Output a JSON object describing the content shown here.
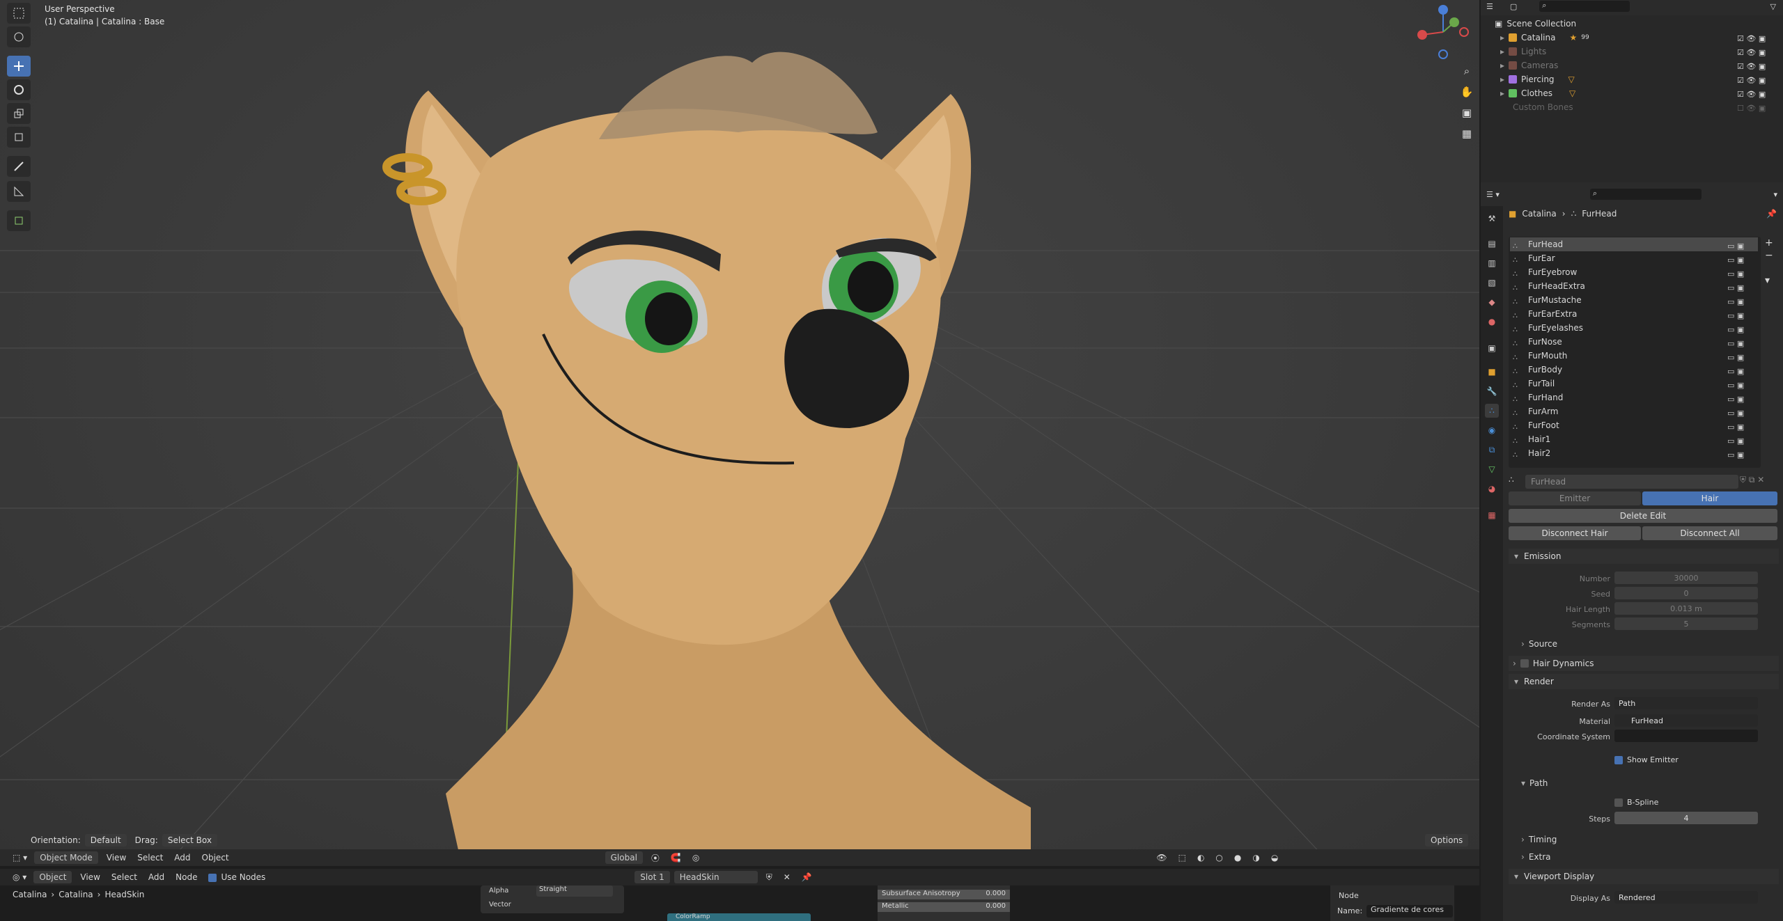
{
  "viewport": {
    "perspective_label": "User Perspective",
    "object_label": "(1) Catalina | Catalina : Base",
    "orientation_label": "Orientation:",
    "orientation_value": "Default",
    "drag_label": "Drag:",
    "drag_value": "Select Box",
    "options_label": "Options"
  },
  "viewport_header": {
    "mode": "Object Mode",
    "menus": [
      "View",
      "Select",
      "Add",
      "Object"
    ],
    "transform_orientation": "Global"
  },
  "node_editor": {
    "editor_type": "Object",
    "menus": [
      "View",
      "Select",
      "Add",
      "Node"
    ],
    "use_nodes_label": "Use Nodes",
    "slot": "Slot 1",
    "material": "HeadSkin",
    "breadcrumb": [
      "Catalina",
      "Catalina",
      "HeadSkin"
    ],
    "alpha_label": "Alpha",
    "alpha_value": "Straight",
    "vector_label": "Vector",
    "colorramp_label": "ColorRamp",
    "subsurface_label": "Subsurface Anisotropy",
    "subsurface_value": "0.000",
    "metallic_label": "Metallic",
    "metallic_value": "0.000",
    "node_panel_label": "Node",
    "name_label": "Name:",
    "name_value": "Gradiente de cores"
  },
  "outliner": {
    "root": "Scene Collection",
    "items": [
      {
        "label": "Catalina",
        "color": "#e0a030",
        "badge": "99"
      },
      {
        "label": "Lights",
        "color": "#c07060",
        "badge": ""
      },
      {
        "label": "Cameras",
        "color": "#c07060",
        "badge": ""
      },
      {
        "label": "Piercing",
        "color": "#a070e0",
        "badge": ""
      },
      {
        "label": "Clothes",
        "color": "#60c060",
        "badge": ""
      },
      {
        "label": "Custom Bones",
        "color": "#666666",
        "badge": ""
      }
    ]
  },
  "properties": {
    "breadcrumb": [
      "Catalina",
      "FurHead"
    ],
    "particle_systems": [
      "FurHead",
      "FurEar",
      "FurEyebrow",
      "FurHeadExtra",
      "FurMustache",
      "FurEarExtra",
      "FurEyelashes",
      "FurNose",
      "FurMouth",
      "FurBody",
      "FurTail",
      "FurHand",
      "FurArm",
      "FurFoot",
      "Hair1",
      "Hair2"
    ],
    "settings_name": "FurHead",
    "type_tabs": [
      "Emitter",
      "Hair"
    ],
    "delete_edit": "Delete Edit",
    "disconnect_hair": "Disconnect Hair",
    "disconnect_all": "Disconnect All",
    "emission": {
      "title": "Emission",
      "number_label": "Number",
      "number_value": "30000",
      "seed_label": "Seed",
      "seed_value": "0",
      "hair_length_label": "Hair Length",
      "hair_length_value": "0.013 m",
      "segments_label": "Segments",
      "segments_value": "5"
    },
    "source_label": "Source",
    "hair_dynamics_label": "Hair Dynamics",
    "render": {
      "title": "Render",
      "render_as_label": "Render As",
      "render_as_value": "Path",
      "material_label": "Material",
      "material_value": "FurHead",
      "coord_label": "Coordinate System",
      "show_emitter_label": "Show Emitter"
    },
    "path": {
      "title": "Path",
      "bspline_label": "B-Spline",
      "steps_label": "Steps",
      "steps_value": "4"
    },
    "timing_label": "Timing",
    "extra_label": "Extra",
    "viewport_display": {
      "title": "Viewport Display",
      "display_as_label": "Display As",
      "display_as_value": "Rendered"
    }
  },
  "colors": {
    "accent": "#4772b3",
    "viewport_bg": "#3d3d3d",
    "skin": "#d6aa72",
    "eye_green": "#3a9a45"
  }
}
